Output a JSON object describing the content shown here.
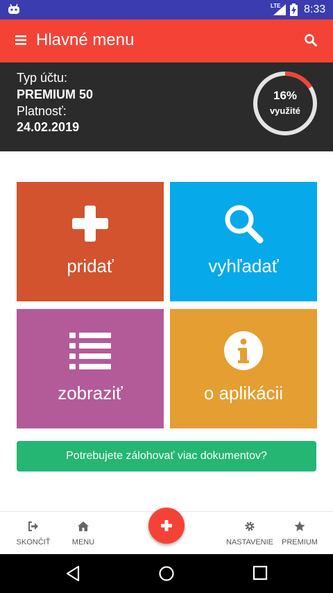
{
  "status_bar": {
    "network": "LTE",
    "time": "8:33"
  },
  "app_bar": {
    "title": "Hlavné menu"
  },
  "account": {
    "type_label": "Typ účtu:",
    "type_value": "PREMIUM 50",
    "validity_label": "Platnosť:",
    "validity_value": "24.02.2019",
    "usage_percent": "16%",
    "usage_fraction": 0.16,
    "usage_label": "využité"
  },
  "tiles": [
    {
      "label": "pridať",
      "color": "#d2532e",
      "icon": "plus-icon"
    },
    {
      "label": "vyhľadať",
      "color": "#06a9ea",
      "icon": "search-icon"
    },
    {
      "label": "zobraziť",
      "color": "#b35a99",
      "icon": "list-icon"
    },
    {
      "label": "o aplikácii",
      "color": "#e59e32",
      "icon": "info-icon"
    }
  ],
  "cta": {
    "label": "Potrebujete zálohovať viac dokumentov?"
  },
  "bottom_nav": {
    "exit": "SKONČIŤ",
    "menu": "MENU",
    "settings": "NASTAVENIE",
    "premium": "PREMIUM"
  },
  "colors": {
    "accent": "#f44336",
    "header_dark": "#2b2b2b",
    "status_bar": "#3a3cb0",
    "cta_green": "#24b672"
  }
}
